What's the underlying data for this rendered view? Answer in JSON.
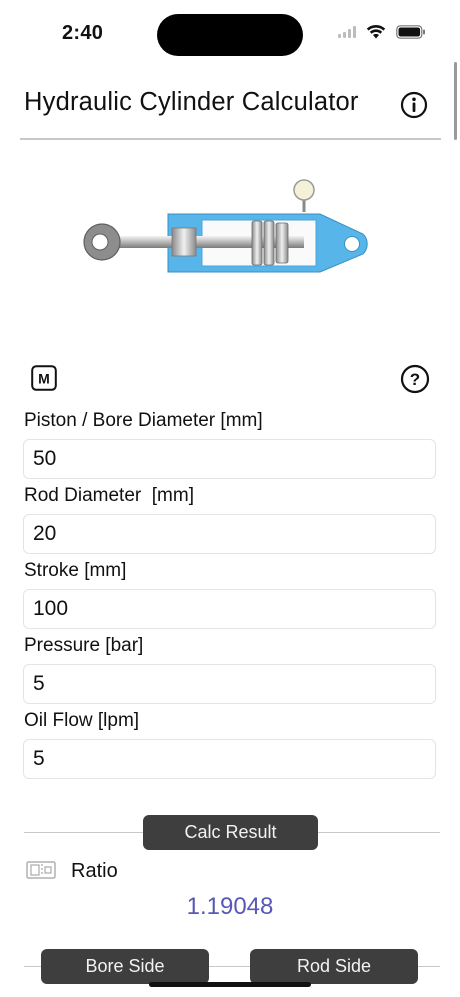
{
  "status_bar": {
    "time": "2:40"
  },
  "header": {
    "title": "Hydraulic Cylinder Calculator"
  },
  "toolbar": {
    "metric_label": "M",
    "help_label": "?"
  },
  "fields": [
    {
      "label": "Piston / Bore Diameter [mm]",
      "value": "50"
    },
    {
      "label": "Rod Diameter  [mm]",
      "value": "20"
    },
    {
      "label": "Stroke [mm]",
      "value": "100"
    },
    {
      "label": "Pressure [bar]",
      "value": "5"
    },
    {
      "label": "Oil Flow [lpm]",
      "value": "5"
    }
  ],
  "results": {
    "section_label": "Calc Result",
    "ratio_label": "Ratio",
    "ratio_value": "1.19048"
  },
  "tabs": {
    "bore_side": "Bore Side",
    "rod_side": "Rod Side"
  },
  "colors": {
    "accent_value": "#5a58b6",
    "cylinder_body": "#57b5ea",
    "button_bg": "#3e3e3e"
  }
}
